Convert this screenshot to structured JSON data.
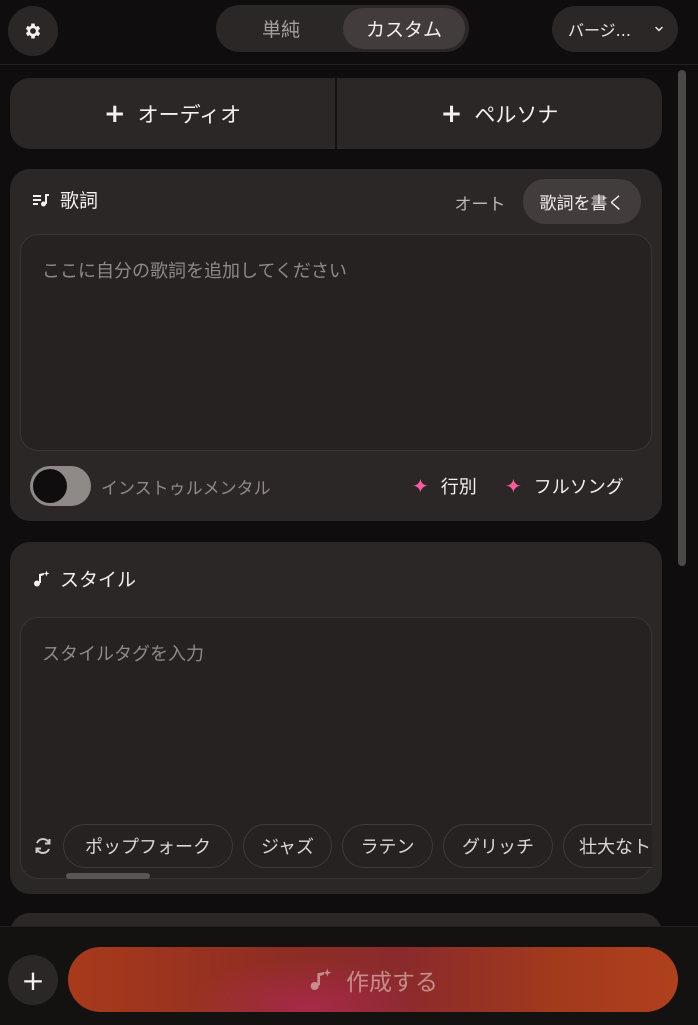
{
  "header": {
    "settings_icon": "gear-icon",
    "modes": [
      "単純",
      "カスタム"
    ],
    "active_mode": "カスタム",
    "version_label": "バージ...",
    "version_icon": "chevron-down-icon"
  },
  "add_row": {
    "audio_label": "オーディオ",
    "persona_label": "ペルソナ"
  },
  "lyrics": {
    "title": "歌詞",
    "title_icon": "lyrics-icon",
    "mode_auto": "オート",
    "mode_write": "歌詞を書く",
    "placeholder": "ここに自分の歌詞を追加してください",
    "instrumental_label": "インストゥルメンタル",
    "instrumental_on": false,
    "gen_line": "行別",
    "gen_full": "フルソング",
    "accent_color": "#ff5aa0"
  },
  "style": {
    "title": "スタイル",
    "title_icon": "music-sparkle-icon",
    "placeholder": "スタイルタグを入力",
    "refresh_icon": "refresh-icon",
    "tags": [
      "ポップフォーク",
      "ジャズ",
      "ラテン",
      "グリッチ",
      "壮大なト"
    ]
  },
  "footer": {
    "plus_label": "+",
    "create_label": "作成する",
    "create_icon": "music-sparkle-icon"
  }
}
